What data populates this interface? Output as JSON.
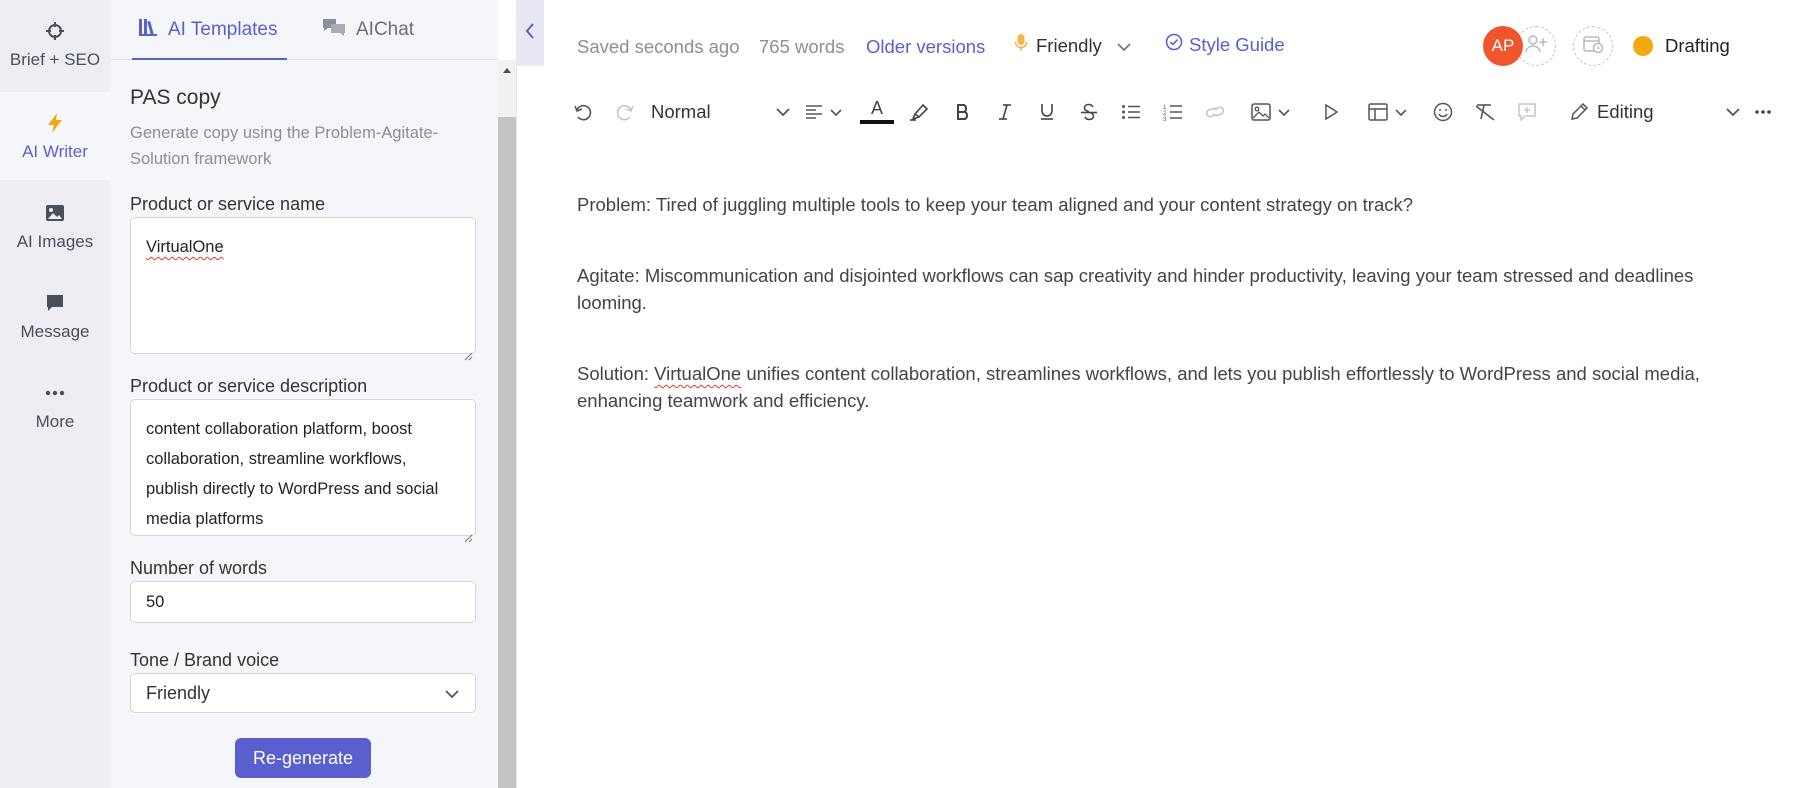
{
  "rail": {
    "items": [
      {
        "label": "Brief + SEO",
        "icon": "crosshair-icon"
      },
      {
        "label": "AI Writer",
        "icon": "lightning-icon"
      },
      {
        "label": "AI Images",
        "icon": "image-icon"
      },
      {
        "label": "Message",
        "icon": "message-icon"
      },
      {
        "label": "More",
        "icon": "more-dots-icon"
      }
    ]
  },
  "panel": {
    "tabs": [
      {
        "label": "AI Templates",
        "icon": "library-icon"
      },
      {
        "label": "AIChat",
        "icon": "chat-bubbles-icon"
      }
    ],
    "template_title": "PAS copy",
    "template_description": "Generate copy using the Problem-Agitate-Solution framework",
    "fields": {
      "product_name_label": "Product or service name",
      "product_name_value": "VirtualOne",
      "product_desc_label": "Product or service description",
      "product_desc_value": "content collaboration platform, boost collaboration, streamline workflows, publish directly to WordPress and social media platforms",
      "word_count_label": "Number of words",
      "word_count_value": "50",
      "tone_label": "Tone / Brand voice",
      "tone_value": "Friendly"
    },
    "regenerate_label": "Re-generate"
  },
  "header": {
    "saved_text": "Saved seconds ago",
    "word_count": "765 words",
    "older_versions": "Older versions",
    "tone": "Friendly",
    "style_guide": "Style Guide",
    "avatar_initials": "AP",
    "status": "Drafting",
    "colors": {
      "accent": "#5a5fd0",
      "avatar": "#f0552b",
      "status": "#f2a80f"
    }
  },
  "toolbar": {
    "text_style": "Normal",
    "mode": "Editing"
  },
  "editor": {
    "problem": "Problem: Tired of juggling multiple tools to keep your team aligned and your content strategy on track?",
    "agitate": "Agitate: Miscommunication and disjointed workflows can sap creativity and hinder productivity, leaving your team stressed and deadlines looming.",
    "solution_prefix": "Solution: ",
    "solution_brand": "VirtualOne",
    "solution_rest": " unifies content collaboration, streamlines workflows, and lets you publish effortlessly to WordPress and social media, enhancing teamwork and efficiency."
  }
}
